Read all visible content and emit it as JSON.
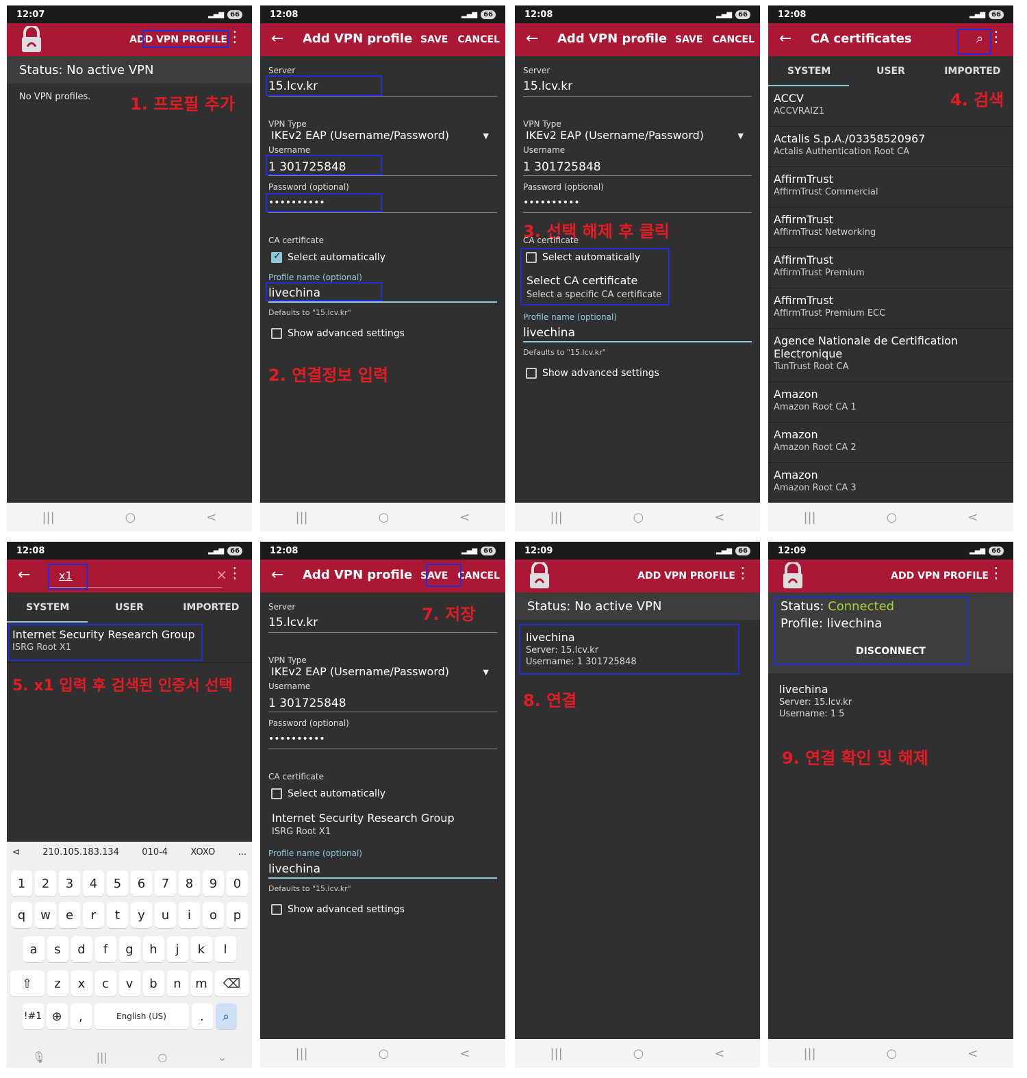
{
  "statusbar": {
    "t1": "12:07",
    "t2": "12:08",
    "t3": "12:09",
    "battery": "66"
  },
  "appbar": {
    "add_vpn_profile": "ADD VPN PROFILE",
    "add_vpn_title": "Add VPN profile",
    "save": "SAVE",
    "cancel": "CANCEL",
    "ca_title": "CA certificates"
  },
  "main": {
    "status_none": "Status: No active VPN",
    "no_profiles": "No VPN profiles.",
    "status_label": "Status:",
    "status_connected": "Connected",
    "profile_line": "Profile: livechina",
    "disconnect": "DISCONNECT"
  },
  "form": {
    "server_label": "Server",
    "server_value": "15.lcv.kr",
    "vpn_type_label": "VPN Type",
    "vpn_type_value": "IKEv2 EAP (Username/Password)",
    "username_label": "Username",
    "username_value": "1 301725848",
    "password_label": "Password (optional)",
    "password_value": "••••••••••",
    "ca_label": "CA certificate",
    "select_auto": "Select automatically",
    "select_ca_title": "Select CA certificate",
    "select_ca_sub": "Select a specific CA certificate",
    "profile_name_label": "Profile name (optional)",
    "profile_name_value": "livechina",
    "defaults": "Defaults to \"15.lcv.kr\"",
    "advanced": "Show advanced settings"
  },
  "tabs": [
    "SYSTEM",
    "USER",
    "IMPORTED"
  ],
  "certs": [
    {
      "t": "ACCV",
      "s": "ACCVRAIZ1"
    },
    {
      "t": "Actalis S.p.A./03358520967",
      "s": "Actalis Authentication Root CA"
    },
    {
      "t": "AffirmTrust",
      "s": "AffirmTrust Commercial"
    },
    {
      "t": "AffirmTrust",
      "s": "AffirmTrust Networking"
    },
    {
      "t": "AffirmTrust",
      "s": "AffirmTrust Premium"
    },
    {
      "t": "AffirmTrust",
      "s": "AffirmTrust Premium ECC"
    },
    {
      "t": "Agence Nationale de Certification Electronique",
      "s": "TunTrust Root CA"
    },
    {
      "t": "Amazon",
      "s": "Amazon Root CA 1"
    },
    {
      "t": "Amazon",
      "s": "Amazon Root CA 2"
    },
    {
      "t": "Amazon",
      "s": "Amazon Root CA 3"
    }
  ],
  "search": {
    "query": "x1",
    "result_title": "Internet Security Research Group",
    "result_sub": "ISRG Root X1"
  },
  "profile": {
    "name": "livechina",
    "server": "Server: 15.lcv.kr",
    "username": "Username: 1 301725848",
    "username2": "Username: 1   5"
  },
  "keyboard": {
    "sugg": [
      "210.105.183.134",
      "010-4",
      "XOXO",
      "..."
    ],
    "nums": [
      "1",
      "2",
      "3",
      "4",
      "5",
      "6",
      "7",
      "8",
      "9",
      "0"
    ],
    "row1": [
      "q",
      "w",
      "e",
      "r",
      "t",
      "y",
      "u",
      "i",
      "o",
      "p"
    ],
    "row2": [
      "a",
      "s",
      "d",
      "f",
      "g",
      "h",
      "j",
      "k",
      "l"
    ],
    "row3": [
      "z",
      "x",
      "c",
      "v",
      "b",
      "n",
      "m"
    ],
    "sym": "!#1",
    "comma": ",",
    "space": "English (US)",
    "dot": "."
  },
  "steps": {
    "s1": "1. 프로필 추가",
    "s2": "2. 연결정보 입력",
    "s3": "3. 선택 해제 후 클릭",
    "s4": "4. 검색",
    "s5": "5. x1 입력 후 검색된 인증서 선택",
    "s7": "7. 저장",
    "s8": "8. 연결",
    "s9": "9. 연결 확인 및 해제"
  }
}
